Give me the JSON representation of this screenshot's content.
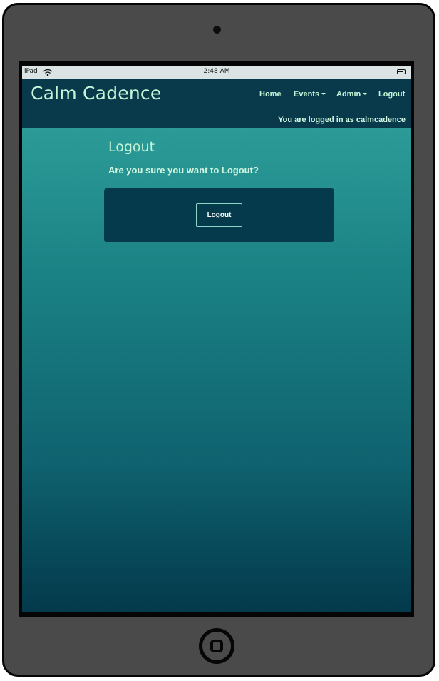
{
  "status_bar": {
    "device": "iPad",
    "time": "2:48 AM",
    "wifi_icon": "wifi-icon",
    "battery_icon": "battery-icon"
  },
  "navbar": {
    "brand": "Calm Cadence",
    "links": {
      "home": "Home",
      "events": "Events",
      "admin": "Admin",
      "logout": "Logout"
    },
    "dropdown_icon": "caret-down-icon",
    "logged_in_text": "You are logged in as calmcadence"
  },
  "main": {
    "title": "Logout",
    "question": "Are you sure you want to Logout?",
    "logout_button_label": "Logout"
  },
  "colors": {
    "navbar_bg": "#083a4b",
    "accent_text": "#c5f5d6",
    "gradient_top": "#33a6a0",
    "gradient_bottom": "#03394b",
    "card_bg": "#05394c",
    "device_frame": "#4a4a4a"
  }
}
